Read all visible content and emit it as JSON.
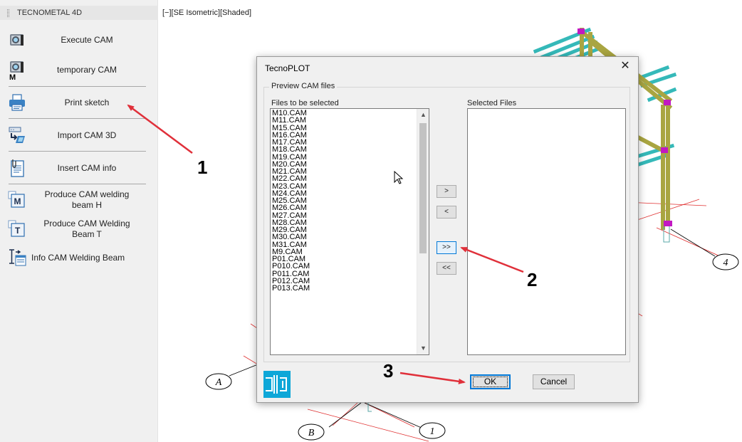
{
  "palette": {
    "title": "TECNOMETAL 4D",
    "items": [
      {
        "label": "Execute CAM",
        "icon": "camera-icon"
      },
      {
        "label": "temporary CAM",
        "icon": "camera-m-icon"
      },
      {
        "label": "Print sketch",
        "icon": "printer-icon"
      },
      {
        "label": "Import CAM 3D",
        "icon": "import-cam-icon"
      },
      {
        "label": "Insert CAM info",
        "icon": "document-clip-icon"
      },
      {
        "label": "Produce CAM welding\nbeam H",
        "icon": "m-box-icon"
      },
      {
        "label": "Produce CAM Welding\nBeam T",
        "icon": "t-box-icon"
      },
      {
        "label": "Info CAM Welding Beam",
        "icon": "i-beam-info-icon"
      }
    ]
  },
  "viewport": {
    "label": "[−][SE Isometric][Shaded]",
    "grid_bubbles": [
      "4",
      "A",
      "B",
      "1"
    ]
  },
  "dialog": {
    "title": "TecnoPLOT",
    "close_glyph": "✕",
    "group_label": "Preview CAM files",
    "left_label": "Files to be selected",
    "right_label": "Selected Files",
    "files": [
      "M10.CAM",
      "M11.CAM",
      "M15.CAM",
      "M16.CAM",
      "M17.CAM",
      "M18.CAM",
      "M19.CAM",
      "M20.CAM",
      "M21.CAM",
      "M22.CAM",
      "M23.CAM",
      "M24.CAM",
      "M25.CAM",
      "M26.CAM",
      "M27.CAM",
      "M28.CAM",
      "M29.CAM",
      "M30.CAM",
      "M31.CAM",
      "M9.CAM",
      "P01.CAM",
      "P010.CAM",
      "P011.CAM",
      "P012.CAM",
      "P013.CAM"
    ],
    "selected_files": [],
    "btn_add": ">",
    "btn_remove": "<",
    "btn_add_all": ">>",
    "btn_remove_all": "<<",
    "ok_label": "OK",
    "cancel_label": "Cancel"
  },
  "annotations": [
    "1",
    "2",
    "3"
  ],
  "colors": {
    "accent": "#0078d7",
    "arrow": "#e0303a",
    "beam_cyan": "#35b9b9",
    "column_olive": "#a9a541",
    "node_purple": "#c218c2",
    "grid_red": "#e03030"
  }
}
